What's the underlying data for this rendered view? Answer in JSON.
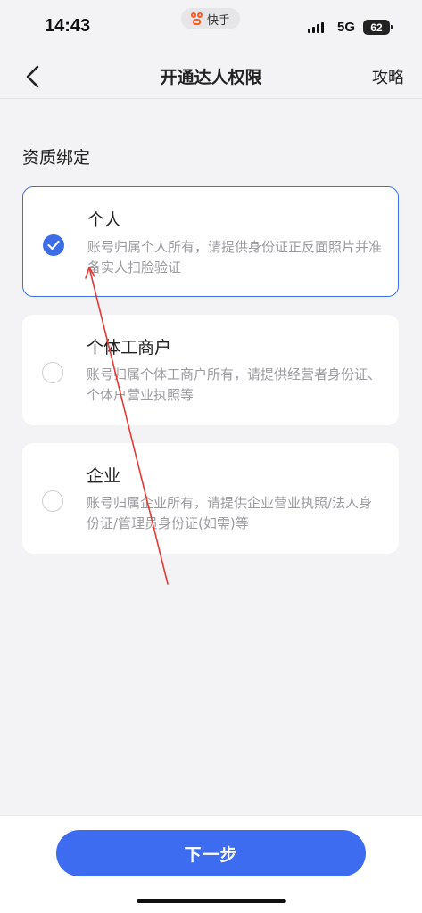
{
  "status_bar": {
    "time": "14:43",
    "app_name": "快手",
    "network": "5G",
    "battery": "62"
  },
  "nav": {
    "title": "开通达人权限",
    "right_link": "攻略",
    "back_icon": "chevron-left-icon"
  },
  "section": {
    "title": "资质绑定"
  },
  "options": [
    {
      "title": "个人",
      "desc": "账号归属个人所有，请提供身份证正反面照片并准备实人扫脸验证",
      "selected": true
    },
    {
      "title": "个体工商户",
      "desc": "账号归属个体工商户所有，请提供经营者身份证、个体户营业执照等",
      "selected": false
    },
    {
      "title": "企业",
      "desc": "账号归属企业所有，请提供企业营业执照/法人身份证/管理员身份证(如需)等",
      "selected": false
    }
  ],
  "footer": {
    "next_label": "下一步"
  },
  "colors": {
    "accent": "#3d6de8",
    "annotation": "#e53935"
  }
}
